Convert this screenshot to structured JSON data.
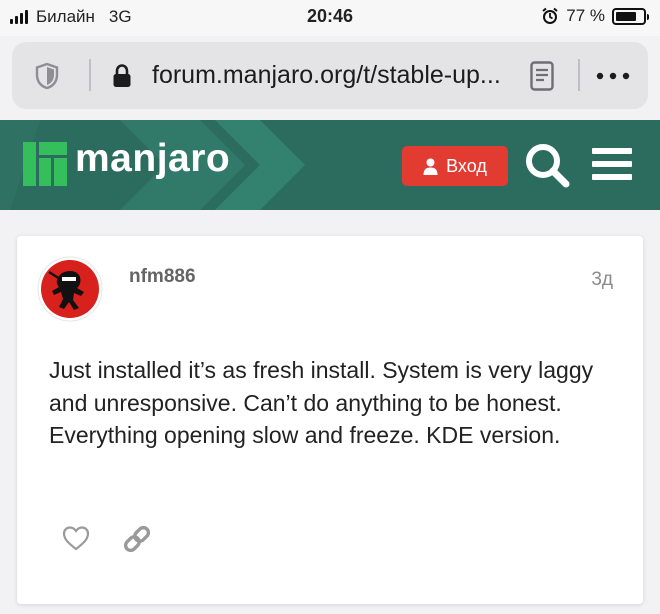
{
  "status_bar": {
    "carrier": "Билайн",
    "network": "3G",
    "time": "20:46",
    "battery": "77 %",
    "battery_level": 0.77
  },
  "browser": {
    "url": "forum.manjaro.org/t/stable-up..."
  },
  "header": {
    "logo_text": "manjaro",
    "login_label": "Вход",
    "brand_color": "#2c6c5e",
    "accent_color": "#35bf5c"
  },
  "post": {
    "username": "nfm886",
    "date": "3д",
    "body": "Just installed it’s as fresh install. System is very laggy and unresponsive. Can’t do anything to be honest. Everything opening slow and freeze. KDE version."
  },
  "icons": [
    "shield-icon",
    "lock-icon",
    "reader-icon",
    "more-icon",
    "user-icon",
    "search-icon",
    "menu-icon",
    "heart-icon",
    "link-icon"
  ]
}
